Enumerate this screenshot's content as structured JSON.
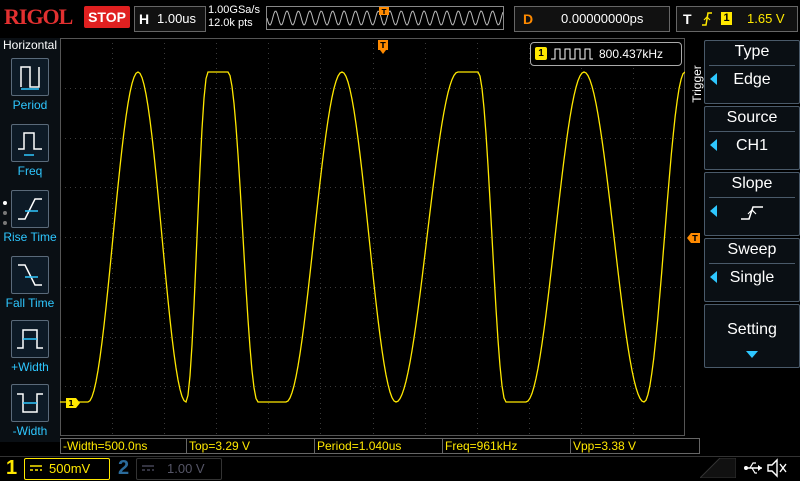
{
  "brand": "RIGOL",
  "run_state": "STOP",
  "horizontal": {
    "key": "H",
    "scale": "1.00us",
    "sample_rate": "1.00GSa/s",
    "points": "12.0k pts"
  },
  "delay": {
    "key": "D",
    "value": "0.00000000ps"
  },
  "trigger_status": {
    "key": "T",
    "channel": "1",
    "level": "1.65 V"
  },
  "left_menu": {
    "title": "Horizontal",
    "items": [
      {
        "label": "Period",
        "icon": "period-icon"
      },
      {
        "label": "Freq",
        "icon": "freq-icon"
      },
      {
        "label": "Rise Time",
        "icon": "rise-time-icon"
      },
      {
        "label": "Fall Time",
        "icon": "fall-time-icon"
      },
      {
        "label": "+Width",
        "icon": "pos-width-icon"
      },
      {
        "label": "-Width",
        "icon": "neg-width-icon"
      }
    ]
  },
  "freq_counter": {
    "channel": "1",
    "value": "800.437kHz"
  },
  "markers": {
    "channel": "1",
    "trigger": "T"
  },
  "measurements": [
    "-Width=500.0ns",
    "Top=3.29 V",
    "Period=1.040us",
    "Freq=961kHz",
    "Vpp=3.38 V"
  ],
  "trigger_menu": {
    "tab": "Trigger",
    "type": {
      "title": "Type",
      "value": "Edge"
    },
    "source": {
      "title": "Source",
      "value": "CH1"
    },
    "slope": {
      "title": "Slope"
    },
    "sweep": {
      "title": "Sweep",
      "value": "Single"
    },
    "setting": {
      "title": "Setting"
    }
  },
  "channels": [
    {
      "number": "1",
      "scale": "500mV",
      "color": "#ffe800"
    },
    {
      "number": "2",
      "scale": "1.00 V",
      "color": "#2a6a9a"
    }
  ],
  "colors": {
    "waveform": "#ffe800",
    "trigger_marker": "#ff8a00",
    "menu_accent": "#2ec7ff",
    "stop": "#e02020"
  }
}
